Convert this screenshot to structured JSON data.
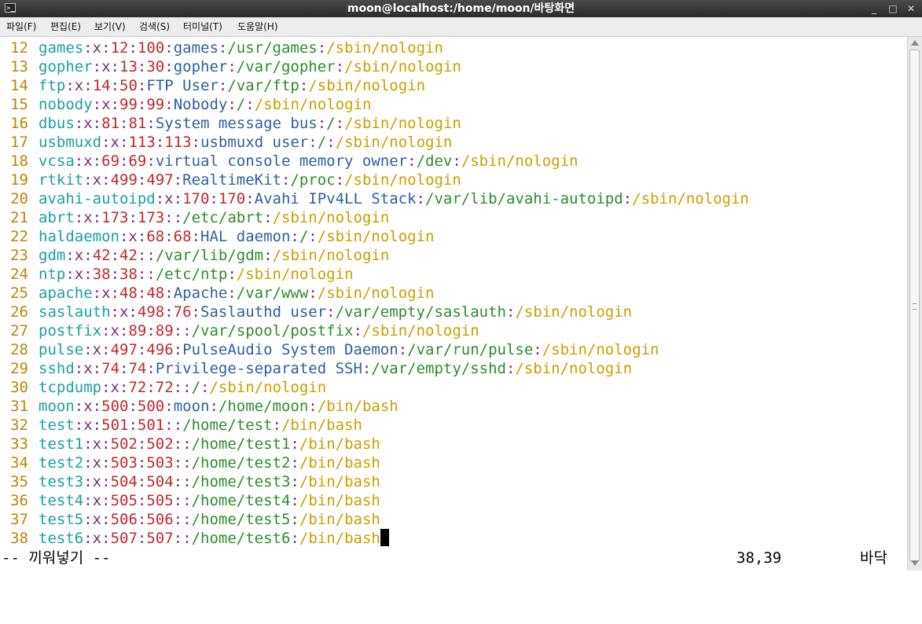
{
  "window": {
    "title": "moon@localhost:/home/moon/바탕화면",
    "minimize": "_",
    "maximize": "□",
    "close": "✕"
  },
  "menu": [
    "파일(F)",
    "편집(E)",
    "보기(V)",
    "검색(S)",
    "터미널(T)",
    "도움말(H)"
  ],
  "lines": [
    {
      "n": "12",
      "user": "games",
      "uid": "12",
      "gid": "100",
      "gecos": "games",
      "home": "/usr/games",
      "shell": "/sbin/nologin"
    },
    {
      "n": "13",
      "user": "gopher",
      "uid": "13",
      "gid": "30",
      "gecos": "gopher",
      "home": "/var/gopher",
      "shell": "/sbin/nologin"
    },
    {
      "n": "14",
      "user": "ftp",
      "uid": "14",
      "gid": "50",
      "gecos": "FTP User",
      "home": "/var/ftp",
      "shell": "/sbin/nologin"
    },
    {
      "n": "15",
      "user": "nobody",
      "uid": "99",
      "gid": "99",
      "gecos": "Nobody",
      "home": "/",
      "shell": "/sbin/nologin"
    },
    {
      "n": "16",
      "user": "dbus",
      "uid": "81",
      "gid": "81",
      "gecos": "System message bus",
      "home": "/",
      "shell": "/sbin/nologin"
    },
    {
      "n": "17",
      "user": "usbmuxd",
      "uid": "113",
      "gid": "113",
      "gecos": "usbmuxd user",
      "home": "/",
      "shell": "/sbin/nologin"
    },
    {
      "n": "18",
      "user": "vcsa",
      "uid": "69",
      "gid": "69",
      "gecos": "virtual console memory owner",
      "home": "/dev",
      "shell": "/sbin/nologin"
    },
    {
      "n": "19",
      "user": "rtkit",
      "uid": "499",
      "gid": "497",
      "gecos": "RealtimeKit",
      "home": "/proc",
      "shell": "/sbin/nologin"
    },
    {
      "n": "20",
      "user": "avahi-autoipd",
      "uid": "170",
      "gid": "170",
      "gecos": "Avahi IPv4LL Stack",
      "home": "/var/lib/avahi-autoipd",
      "shell": "/sbin/nologin"
    },
    {
      "n": "21",
      "user": "abrt",
      "uid": "173",
      "gid": "173",
      "gecos": "",
      "home": "/etc/abrt",
      "shell": "/sbin/nologin"
    },
    {
      "n": "22",
      "user": "haldaemon",
      "uid": "68",
      "gid": "68",
      "gecos": "HAL daemon",
      "home": "/",
      "shell": "/sbin/nologin"
    },
    {
      "n": "23",
      "user": "gdm",
      "uid": "42",
      "gid": "42",
      "gecos": "",
      "home": "/var/lib/gdm",
      "shell": "/sbin/nologin"
    },
    {
      "n": "24",
      "user": "ntp",
      "uid": "38",
      "gid": "38",
      "gecos": "",
      "home": "/etc/ntp",
      "shell": "/sbin/nologin"
    },
    {
      "n": "25",
      "user": "apache",
      "uid": "48",
      "gid": "48",
      "gecos": "Apache",
      "home": "/var/www",
      "shell": "/sbin/nologin"
    },
    {
      "n": "26",
      "user": "saslauth",
      "uid": "498",
      "gid": "76",
      "gecos": "Saslauthd user",
      "home": "/var/empty/saslauth",
      "shell": "/sbin/nologin"
    },
    {
      "n": "27",
      "user": "postfix",
      "uid": "89",
      "gid": "89",
      "gecos": "",
      "home": "/var/spool/postfix",
      "shell": "/sbin/nologin"
    },
    {
      "n": "28",
      "user": "pulse",
      "uid": "497",
      "gid": "496",
      "gecos": "PulseAudio System Daemon",
      "home": "/var/run/pulse",
      "shell": "/sbin/nologin"
    },
    {
      "n": "29",
      "user": "sshd",
      "uid": "74",
      "gid": "74",
      "gecos": "Privilege-separated SSH",
      "home": "/var/empty/sshd",
      "shell": "/sbin/nologin"
    },
    {
      "n": "30",
      "user": "tcpdump",
      "uid": "72",
      "gid": "72",
      "gecos": "",
      "home": "/",
      "shell": "/sbin/nologin"
    },
    {
      "n": "31",
      "user": "moon",
      "uid": "500",
      "gid": "500",
      "gecos": "moon",
      "home": "/home/moon",
      "shell": "/bin/bash"
    },
    {
      "n": "32",
      "user": "test",
      "uid": "501",
      "gid": "501",
      "gecos": "",
      "home": "/home/test",
      "shell": "/bin/bash"
    },
    {
      "n": "33",
      "user": "test1",
      "uid": "502",
      "gid": "502",
      "gecos": "",
      "home": "/home/test1",
      "shell": "/bin/bash"
    },
    {
      "n": "34",
      "user": "test2",
      "uid": "503",
      "gid": "503",
      "gecos": "",
      "home": "/home/test2",
      "shell": "/bin/bash"
    },
    {
      "n": "35",
      "user": "test3",
      "uid": "504",
      "gid": "504",
      "gecos": "",
      "home": "/home/test3",
      "shell": "/bin/bash"
    },
    {
      "n": "36",
      "user": "test4",
      "uid": "505",
      "gid": "505",
      "gecos": "",
      "home": "/home/test4",
      "shell": "/bin/bash"
    },
    {
      "n": "37",
      "user": "test5",
      "uid": "506",
      "gid": "506",
      "gecos": "",
      "home": "/home/test5",
      "shell": "/bin/bash"
    },
    {
      "n": "38",
      "user": "test6",
      "uid": "507",
      "gid": "507",
      "gecos": "",
      "home": "/home/test6",
      "shell": "/bin/bash"
    }
  ],
  "status": {
    "mode": "-- 끼워넣기 --",
    "position": "38,39",
    "where": "바닥"
  }
}
